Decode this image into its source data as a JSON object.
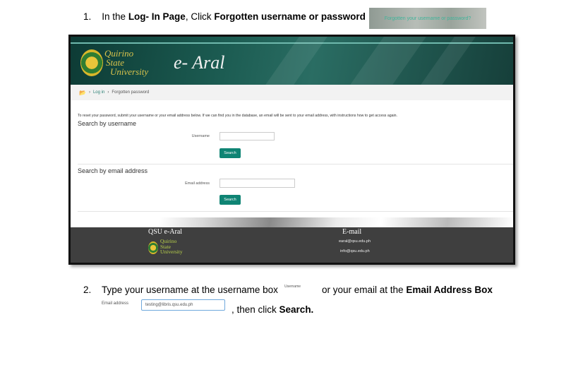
{
  "step1": {
    "num": "1.",
    "t1": "In the ",
    "b1": "Log- In Page",
    "t2": ", Click ",
    "b2": "Forgotten username or password",
    "thumb": "Forgotten your username or password?"
  },
  "shot": {
    "uni_line1": "Quirino",
    "uni_line2": "State",
    "uni_line3": "University",
    "title": "e- Aral",
    "breadcrumb": [
      "Log in",
      "Forgotten password"
    ],
    "instructions": "To reset your password, submit your username or your email address below. If we can find you in the database, an email will be sent to your email address, with instructions how to get access again.",
    "sec_username": "Search by username",
    "username_label": "Username",
    "search_btn": "Search",
    "sec_email": "Search by email address",
    "email_label": "Email address",
    "footer": {
      "left_head": "QSU e-Aral",
      "right_head": "E-mail",
      "uni_line1": "Quirino",
      "uni_line2": "State",
      "uni_line3": "University",
      "email1": "earal@qsu.edu.ph",
      "email2": "info@qsu.edu.ph"
    }
  },
  "step2": {
    "num": "2.",
    "t1": "Type your username at the username box",
    "user_label": "Username",
    "t2": "or your email at the ",
    "b1": "Email Address Box",
    "email_label": "Email address",
    "email_value": "testing@libris.qsu.edu.ph",
    "t3": ", then click ",
    "b2": "Search."
  }
}
